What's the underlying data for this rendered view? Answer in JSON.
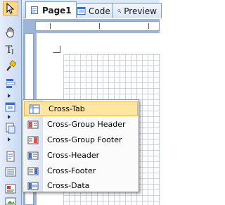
{
  "tabs": [
    {
      "label": "Page1",
      "icon": "page-icon",
      "active": true
    },
    {
      "label": "Code",
      "icon": "code-icon",
      "active": false
    },
    {
      "label": "Preview",
      "icon": "preview-icon",
      "active": false
    }
  ],
  "toolbox": {
    "tools": [
      {
        "icon": "pointer-icon"
      },
      {
        "icon": "hand-icon"
      },
      {
        "icon": "text-tool-icon"
      },
      {
        "icon": "format-painter-icon"
      },
      {
        "icon": "band-tool-icon"
      },
      {
        "icon": "cross-band-tool-icon"
      },
      {
        "icon": "data-band-tool-icon"
      },
      {
        "icon": "page-tool-icon"
      },
      {
        "icon": "list-tool-icon"
      },
      {
        "icon": "report-tool-icon"
      },
      {
        "icon": "image-tool-icon"
      }
    ]
  },
  "menu": {
    "items": [
      {
        "label": "Cross-Tab",
        "icon": "cross-tab-icon",
        "highlighted": true
      },
      {
        "label": "Cross-Group Header",
        "icon": "cross-group-header-icon"
      },
      {
        "label": "Cross-Group Footer",
        "icon": "cross-group-footer-icon"
      },
      {
        "label": "Cross-Header",
        "icon": "cross-header-icon"
      },
      {
        "label": "Cross-Footer",
        "icon": "cross-footer-icon"
      },
      {
        "label": "Cross-Data",
        "icon": "cross-data-icon"
      }
    ]
  },
  "colors": {
    "menu_highlight": "#ffe6a0",
    "toolbar_bg": "#c9d8f2",
    "grid": "#c8d0dc"
  }
}
